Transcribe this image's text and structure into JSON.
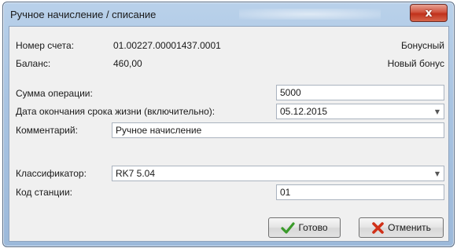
{
  "window": {
    "title": "Ручное начисление / списание",
    "close_glyph": "x"
  },
  "account": {
    "number_label": "Номер счета:",
    "number_value": "01.00227.00001437.0001",
    "number_type": "Бонусный",
    "balance_label": "Баланс:",
    "balance_value": "460,00",
    "balance_type": "Новый бонус"
  },
  "form": {
    "amount_label": "Сумма операции:",
    "amount_value": "5000",
    "expiry_label": "Дата окончания срока жизни (включительно):",
    "expiry_value": "05.12.2015",
    "comment_label": "Комментарий:",
    "comment_value": "Ручное начисление",
    "classifier_label": "Классификатор:",
    "classifier_value": "RK7 5.04",
    "station_label": "Код станции:",
    "station_value": "01"
  },
  "buttons": {
    "ok_label": "Готово",
    "cancel_label": "Отменить"
  },
  "icons": {
    "ok": "checkmark-icon",
    "cancel": "red-x-icon",
    "dropdown": "chevron-down-icon"
  },
  "colors": {
    "ok_icon": "#3a9a2a",
    "cancel_icon": "#d03018"
  }
}
